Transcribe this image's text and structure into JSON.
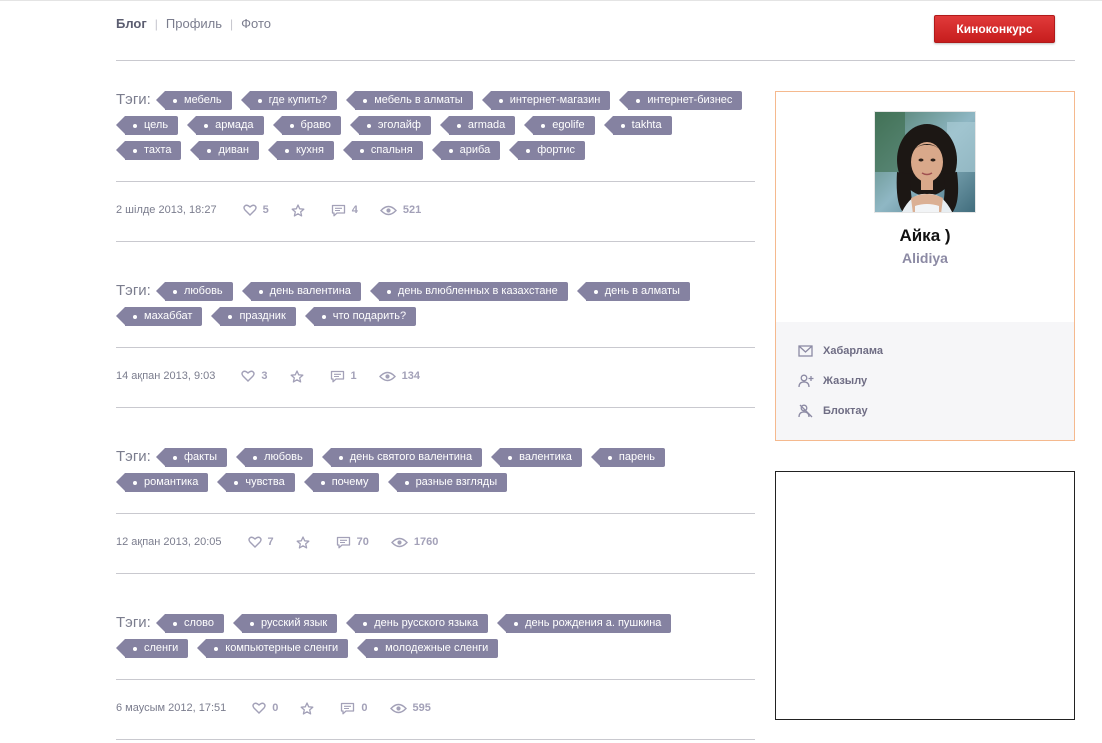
{
  "nav": {
    "items": [
      "Блог",
      "Профиль",
      "Фото"
    ],
    "active": "Блог"
  },
  "contest_button": "Киноконкурс",
  "tags_label": "Тэги:",
  "posts": [
    {
      "tags": [
        "мебель",
        "где купить?",
        "мебель в алматы",
        "интернет-магазин",
        "интернет-бизнес",
        "цель",
        "армада",
        "браво",
        "эголайф",
        "armada",
        "egolife",
        "takhta",
        "тахта",
        "диван",
        "кухня",
        "спальня",
        "ариба",
        "фортис"
      ],
      "date": "2 шілде 2013, 18:27",
      "likes": "5",
      "comments": "4",
      "views": "521"
    },
    {
      "tags": [
        "любовь",
        "день валентина",
        "день влюбленных в казахстане",
        "день в алматы",
        "махаббат",
        "праздник",
        "что подарить?"
      ],
      "date": "14 ақпан 2013, 9:03",
      "likes": "3",
      "comments": "1",
      "views": "134"
    },
    {
      "tags": [
        "факты",
        "любовь",
        "день святого валентина",
        "валентика",
        "парень",
        "романтика",
        "чувства",
        "почему",
        "разные взгляды"
      ],
      "date": "12 ақпан 2013, 20:05",
      "likes": "7",
      "comments": "70",
      "views": "1760"
    },
    {
      "tags": [
        "слово",
        "русский язык",
        "день русского языка",
        "день рождения а. пушкина",
        "сленги",
        "компьютерные сленги",
        "молодежные сленги"
      ],
      "date": "6 маусым 2012, 17:51",
      "likes": "0",
      "comments": "0",
      "views": "595"
    }
  ],
  "profile": {
    "name": "Айка )",
    "login": "Alidiya",
    "actions": [
      {
        "label": "Хабарлама",
        "icon": "envelope-icon"
      },
      {
        "label": "Жазылу",
        "icon": "add-user-icon"
      },
      {
        "label": "Блоктау",
        "icon": "block-user-icon"
      }
    ]
  },
  "colors": {
    "tag_bg": "#8582a1",
    "accent_red": "#d42a2a",
    "card_border": "#f5b98e"
  }
}
